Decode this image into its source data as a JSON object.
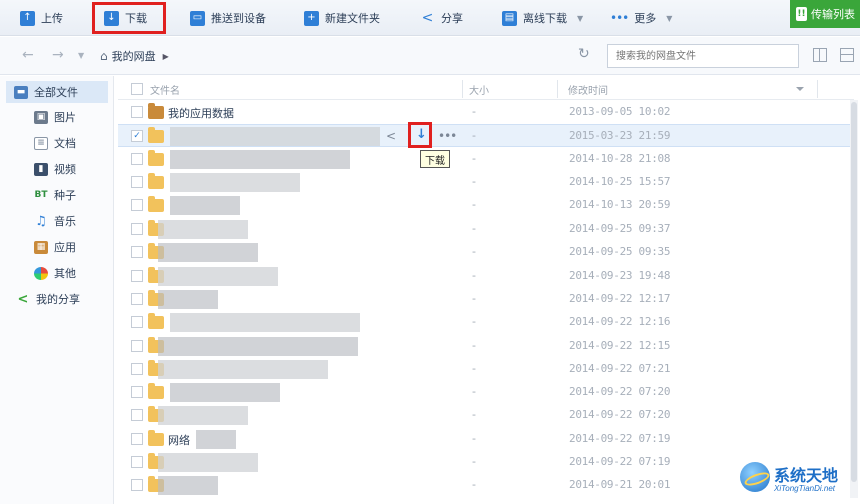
{
  "toolbar": {
    "upload": "上传",
    "download": "下载",
    "push_device": "推送到设备",
    "new_folder": "新建文件夹",
    "share": "分享",
    "offline_download": "离线下载",
    "more": "更多",
    "transfer_list": "传输列表"
  },
  "nav": {
    "breadcrumb": "我的网盘",
    "search_placeholder": "搜索我的网盘文件"
  },
  "sidebar": {
    "items": [
      {
        "label": "全部文件",
        "icon": "all-files-icon"
      },
      {
        "label": "图片",
        "icon": "image-icon"
      },
      {
        "label": "文档",
        "icon": "document-icon"
      },
      {
        "label": "视频",
        "icon": "video-icon"
      },
      {
        "label": "种子",
        "icon": "bt-icon",
        "icon_text": "BT"
      },
      {
        "label": "音乐",
        "icon": "music-icon"
      },
      {
        "label": "应用",
        "icon": "app-icon"
      },
      {
        "label": "其他",
        "icon": "other-icon"
      },
      {
        "label": "我的分享",
        "icon": "share-icon"
      }
    ]
  },
  "file_list": {
    "columns": {
      "name": "文件名",
      "size": "大小",
      "modified": "修改时间"
    },
    "rows": [
      {
        "name": "我的应用数据",
        "size": "-",
        "date": "2013-09-05 10:02",
        "selected": false
      },
      {
        "name": "",
        "size": "-",
        "date": "2015-03-23 21:59",
        "selected": true
      },
      {
        "name": "",
        "size": "-",
        "date": "2014-10-28 21:08",
        "selected": false
      },
      {
        "name": "",
        "size": "-",
        "date": "2014-10-25 15:57",
        "selected": false
      },
      {
        "name": "",
        "size": "-",
        "date": "2014-10-13 20:59",
        "selected": false
      },
      {
        "name": "",
        "size": "-",
        "date": "2014-09-25 09:37",
        "selected": false
      },
      {
        "name": "",
        "size": "-",
        "date": "2014-09-25 09:35",
        "selected": false
      },
      {
        "name": "",
        "size": "-",
        "date": "2014-09-23 19:48",
        "selected": false
      },
      {
        "name": "",
        "size": "-",
        "date": "2014-09-22 12:17",
        "selected": false
      },
      {
        "name": "",
        "size": "-",
        "date": "2014-09-22 12:16",
        "selected": false
      },
      {
        "name": "",
        "size": "-",
        "date": "2014-09-22 12:15",
        "selected": false
      },
      {
        "name": "",
        "size": "-",
        "date": "2014-09-22 07:21",
        "selected": false
      },
      {
        "name": "",
        "size": "-",
        "date": "2014-09-22 07:20",
        "selected": false
      },
      {
        "name": "",
        "size": "-",
        "date": "2014-09-22 07:20",
        "selected": false
      },
      {
        "name": "网络",
        "size": "-",
        "date": "2014-09-22 07:19",
        "selected": false
      },
      {
        "name": "",
        "size": "-",
        "date": "2014-09-22 07:19",
        "selected": false
      },
      {
        "name": "",
        "size": "-",
        "date": "2014-09-21 20:01",
        "selected": false
      }
    ]
  },
  "tooltip": "下载",
  "watermark": {
    "title": "系统天地",
    "subtitle": "XiTongTianDi.net"
  },
  "colors": {
    "accent": "#2f7fd6",
    "highlight": "#e0201f",
    "folder": "#f2c25c",
    "transfer": "#3aa63a"
  }
}
